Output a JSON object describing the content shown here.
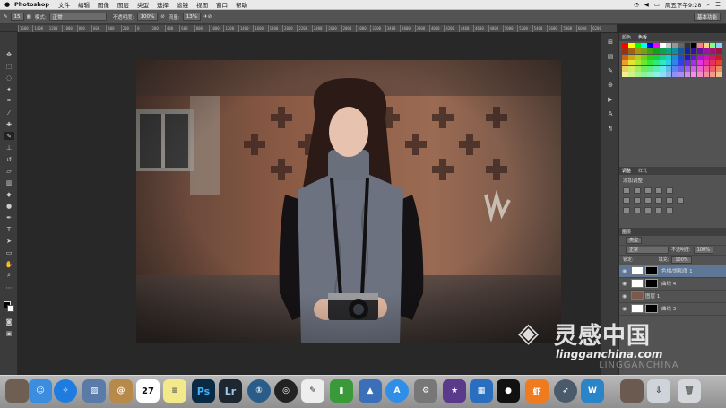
{
  "menubar": {
    "apple": "",
    "app_name": "Photoshop",
    "items": [
      "文件",
      "编辑",
      "图像",
      "图层",
      "类型",
      "选择",
      "滤镜",
      "视图",
      "窗口",
      "帮助"
    ],
    "clock": "周五下午9:28"
  },
  "options": {
    "brush_size": "15",
    "mode_label": "模式:",
    "mode_value": "正常",
    "opacity_label": "不透明度:",
    "opacity_value": "100%",
    "flow_label": "流量:",
    "flow_value": "13%",
    "workspace": "基本功能"
  },
  "ruler_ticks": [
    "1600",
    "1400",
    "1200",
    "1000",
    "800",
    "600",
    "400",
    "200",
    "0",
    "200",
    "400",
    "600",
    "800",
    "1000",
    "1200",
    "1400",
    "1600",
    "1800",
    "2000",
    "2200",
    "2400",
    "2600",
    "2800",
    "3000",
    "3200",
    "3400",
    "3600",
    "3800",
    "4000",
    "4200",
    "4400",
    "4600",
    "4800",
    "5000",
    "5200",
    "5400",
    "5600",
    "5800",
    "6000",
    "6200"
  ],
  "panels": {
    "swatch_tabs": [
      "颜色",
      "色板"
    ],
    "adjust_tabs": [
      "调整",
      "样式"
    ],
    "adjust_title": "添加调整",
    "layers_tab": "图层",
    "kind_label": "类型",
    "blend_value": "正常",
    "opacity_label": "不透明度:",
    "opacity_value": "100%",
    "lock_label": "锁定:",
    "fill_label": "填充:",
    "fill_value": "100%",
    "layers": [
      {
        "name": "色相/饱和度 1",
        "active": true
      },
      {
        "name": "曲线 4",
        "active": false
      },
      {
        "name": "图层 1",
        "active": false
      },
      {
        "name": "曲线 3",
        "active": false
      }
    ]
  },
  "watermark": {
    "cn": "灵感中国",
    "url": "lingganchina.com",
    "faint": "LINGGANCHINA"
  },
  "dock_icons": [
    "finder-icon",
    "safari-icon",
    "preview-icon",
    "contacts-icon",
    "calendar-icon",
    "notes-icon",
    "photoshop-icon",
    "lightroom-icon",
    "1password-icon",
    "dvd-icon",
    "textedit-icon",
    "numbers-icon",
    "keynote-icon",
    "appstore-icon",
    "systemprefs-icon",
    "imovie-icon",
    "photos-icon",
    "qq-icon",
    "xiami-icon",
    "launchpad-icon",
    "wps-icon",
    "downloads-icon",
    "trash-icon"
  ],
  "dock_labels": {
    "calendar_day": "27",
    "ps": "Ps",
    "lr": "Lr"
  },
  "colors": {
    "ps_bg": "#282828",
    "panel": "#535353",
    "active_layer": "#5f7796"
  }
}
